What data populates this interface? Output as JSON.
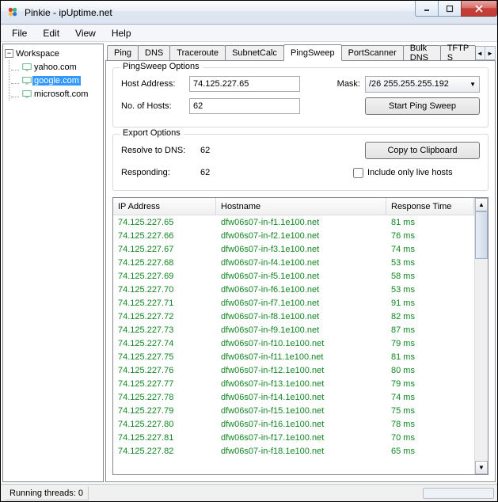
{
  "window": {
    "title": "Pinkie - ipUptime.net"
  },
  "menu": {
    "file": "File",
    "edit": "Edit",
    "view": "View",
    "help": "Help"
  },
  "sidebar": {
    "root": "Workspace",
    "items": [
      {
        "label": "yahoo.com"
      },
      {
        "label": "google.com"
      },
      {
        "label": "microsoft.com"
      }
    ]
  },
  "tabs": {
    "items": [
      "Ping",
      "DNS",
      "Traceroute",
      "SubnetCalc",
      "PingSweep",
      "PortScanner",
      "Bulk DNS",
      "TFTP S"
    ],
    "active": "PingSweep"
  },
  "pingsweep": {
    "options_legend": "PingSweep Options",
    "host_label": "Host Address:",
    "host_value": "74.125.227.65",
    "hosts_label": "No. of Hosts:",
    "hosts_value": "62",
    "mask_label": "Mask:",
    "mask_value": "/26   255.255.255.192",
    "start_btn": "Start Ping Sweep"
  },
  "export": {
    "legend": "Export Options",
    "resolve_label": "Resolve to DNS:",
    "resolve_value": "62",
    "responding_label": "Responding:",
    "responding_value": "62",
    "copy_btn": "Copy to Clipboard",
    "include_label": "Include only live hosts"
  },
  "table": {
    "col_ip": "IP Address",
    "col_host": "Hostname",
    "col_rt": "Response Time",
    "rows": [
      {
        "ip": "74.125.227.65",
        "host": "dfw06s07-in-f1.1e100.net",
        "rt": "81 ms"
      },
      {
        "ip": "74.125.227.66",
        "host": "dfw06s07-in-f2.1e100.net",
        "rt": "76 ms"
      },
      {
        "ip": "74.125.227.67",
        "host": "dfw06s07-in-f3.1e100.net",
        "rt": "74 ms"
      },
      {
        "ip": "74.125.227.68",
        "host": "dfw06s07-in-f4.1e100.net",
        "rt": "53 ms"
      },
      {
        "ip": "74.125.227.69",
        "host": "dfw06s07-in-f5.1e100.net",
        "rt": "58 ms"
      },
      {
        "ip": "74.125.227.70",
        "host": "dfw06s07-in-f6.1e100.net",
        "rt": "53 ms"
      },
      {
        "ip": "74.125.227.71",
        "host": "dfw06s07-in-f7.1e100.net",
        "rt": "91 ms"
      },
      {
        "ip": "74.125.227.72",
        "host": "dfw06s07-in-f8.1e100.net",
        "rt": "82 ms"
      },
      {
        "ip": "74.125.227.73",
        "host": "dfw06s07-in-f9.1e100.net",
        "rt": "87 ms"
      },
      {
        "ip": "74.125.227.74",
        "host": "dfw06s07-in-f10.1e100.net",
        "rt": "79 ms"
      },
      {
        "ip": "74.125.227.75",
        "host": "dfw06s07-in-f11.1e100.net",
        "rt": "81 ms"
      },
      {
        "ip": "74.125.227.76",
        "host": "dfw06s07-in-f12.1e100.net",
        "rt": "80 ms"
      },
      {
        "ip": "74.125.227.77",
        "host": "dfw06s07-in-f13.1e100.net",
        "rt": "79 ms"
      },
      {
        "ip": "74.125.227.78",
        "host": "dfw06s07-in-f14.1e100.net",
        "rt": "74 ms"
      },
      {
        "ip": "74.125.227.79",
        "host": "dfw06s07-in-f15.1e100.net",
        "rt": "75 ms"
      },
      {
        "ip": "74.125.227.80",
        "host": "dfw06s07-in-f16.1e100.net",
        "rt": "78 ms"
      },
      {
        "ip": "74.125.227.81",
        "host": "dfw06s07-in-f17.1e100.net",
        "rt": "70 ms"
      },
      {
        "ip": "74.125.227.82",
        "host": "dfw06s07-in-f18.1e100.net",
        "rt": "65 ms"
      }
    ]
  },
  "status": {
    "threads": "Running threads: 0"
  }
}
